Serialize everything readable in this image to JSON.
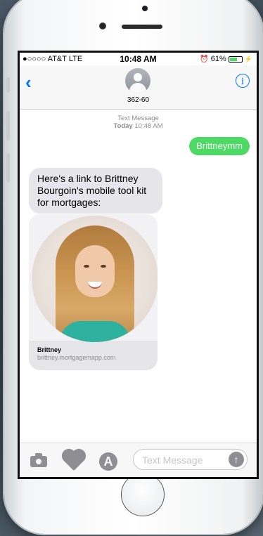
{
  "status": {
    "carrier": "●○○○○ AT&T  LTE",
    "time": "10:48 AM",
    "alarm_icon": "alarm-clock-icon",
    "battery": "61%",
    "battery_level": 0.61
  },
  "nav": {
    "contact": "362-60",
    "back_icon": "chevron-left-icon",
    "info_label": "i"
  },
  "conversation": {
    "service": "Text Message",
    "day": "Today",
    "time": "10:48 AM",
    "sent": "Brittneymm",
    "received": "Here's a link to Brittney Bourgoin's mobile tool kit for mortgages:",
    "link_title": "Brittney",
    "link_url": "brittney.mortgagemapp.com"
  },
  "input": {
    "placeholder": "Text Message",
    "send_icon": "arrow-up-icon",
    "appstore_glyph": "A"
  },
  "colors": {
    "imessage_green": "#4cd964",
    "ios_blue": "#007aff",
    "bubble_gray": "#e5e5ea"
  }
}
